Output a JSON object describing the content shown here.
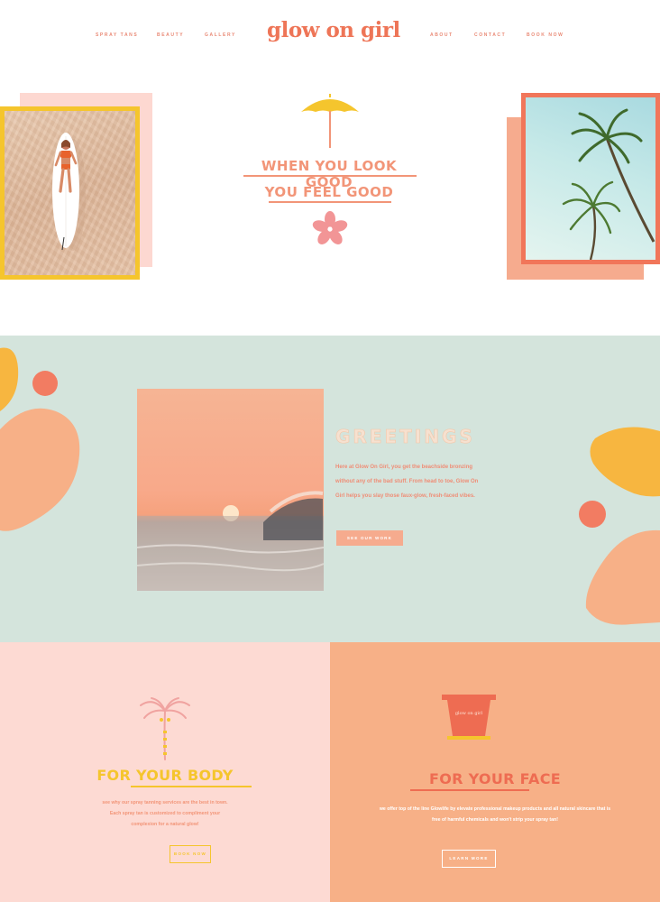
{
  "nav": {
    "left": [
      "SPRAY TANS",
      "BEAUTY",
      "GALLERY"
    ],
    "right": [
      "ABOUT",
      "CONTACT",
      "BOOK NOW"
    ],
    "logo": "glow on girl"
  },
  "hero": {
    "line1": "WHEN YOU LOOK GOOD",
    "line2": "YOU FEEL GOOD"
  },
  "greetings": {
    "title": "GREETINGS",
    "text": "Here at Glow On Girl, you get the beachside bronzing without any of the bad stuff. From head to toe, Glow On Girl helps you slay those faux-glow, fresh-faced vibes.",
    "button": "SEE OUR WORK"
  },
  "services": {
    "body": {
      "title": "FOR YOUR BODY",
      "text": "see why our spray tanning services are the best in town. Each spray tan is customized to compliment your complexion for a natural glow!",
      "button": "BOOK NOW"
    },
    "face": {
      "title": "FOR YOUR FACE",
      "text": "we offer top of the line Glowlife by elevate professional makeup products and all natural skincare that is free of harmful chemicals and won't strip your spray tan!",
      "button": "LEARN MORE",
      "icon_text": "glow on girl"
    }
  },
  "colors": {
    "coral": "#ee7557",
    "peach": "#f7b087",
    "blush": "#fddad3",
    "mint": "#d4e4dc",
    "yellow": "#f5c52d",
    "orange": "#f7b640"
  }
}
